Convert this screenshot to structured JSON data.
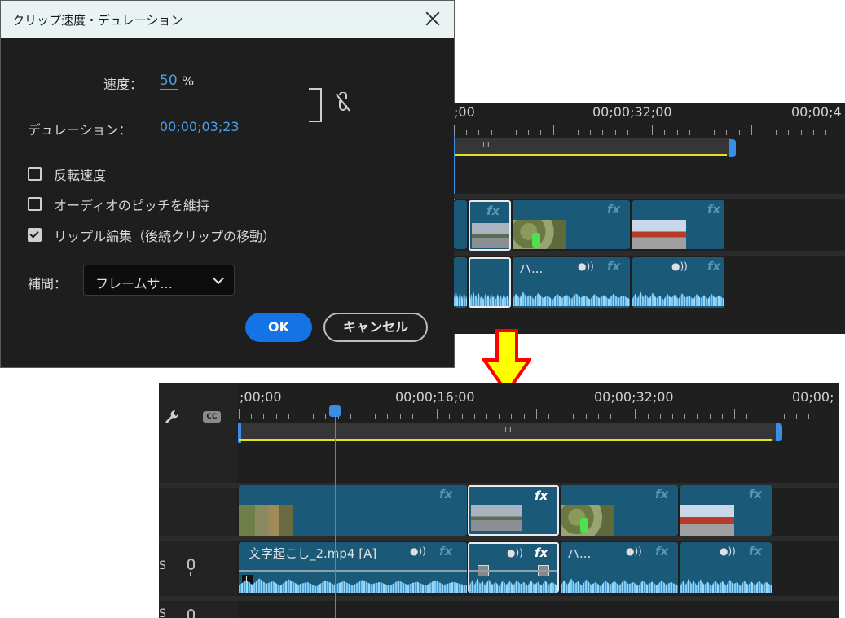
{
  "dialog": {
    "title": "クリップ速度・デュレーション",
    "speed_label": "速度：",
    "speed_value": "50",
    "speed_unit": "%",
    "duration_label": "デュレーション：",
    "duration_value": "00;00;03;23",
    "checkboxes": [
      {
        "label": "反転速度",
        "checked": false
      },
      {
        "label": "オーディオのピッチを維持",
        "checked": false
      },
      {
        "label": "リップル編集（後続クリップの移動）",
        "checked": true
      }
    ],
    "interpolation_label": "補間：",
    "interpolation_value": "フレームサ...",
    "ok_label": "OK",
    "cancel_label": "キャンセル",
    "colors": {
      "accent": "#1473e6",
      "value_blue": "#4a9eea"
    }
  },
  "timeline_before": {
    "timecodes": [
      ";00",
      "00;00;32;00",
      "00;00;4"
    ],
    "work_marker": "III",
    "fx_label": "fx",
    "audio_clip_label": "ハ..."
  },
  "timeline_after": {
    "timecodes": [
      ";00;00",
      "00;00;16;00",
      "00;00;32;00",
      "00;00;"
    ],
    "work_marker": "III",
    "cc_label": "CC",
    "fx_label": "fx",
    "audio_clip_name": "文字起こし_2.mp4 [A]",
    "audio_clip_label2": "ハ...",
    "channel_label": "L",
    "track_s": "S",
    "colors": {
      "clip": "#1a5a78",
      "playhead": "#3a8ee6",
      "work_area": "#e8e020"
    }
  },
  "arrow": {
    "color_fill": "#ffff00",
    "color_stroke": "#ff0000"
  }
}
